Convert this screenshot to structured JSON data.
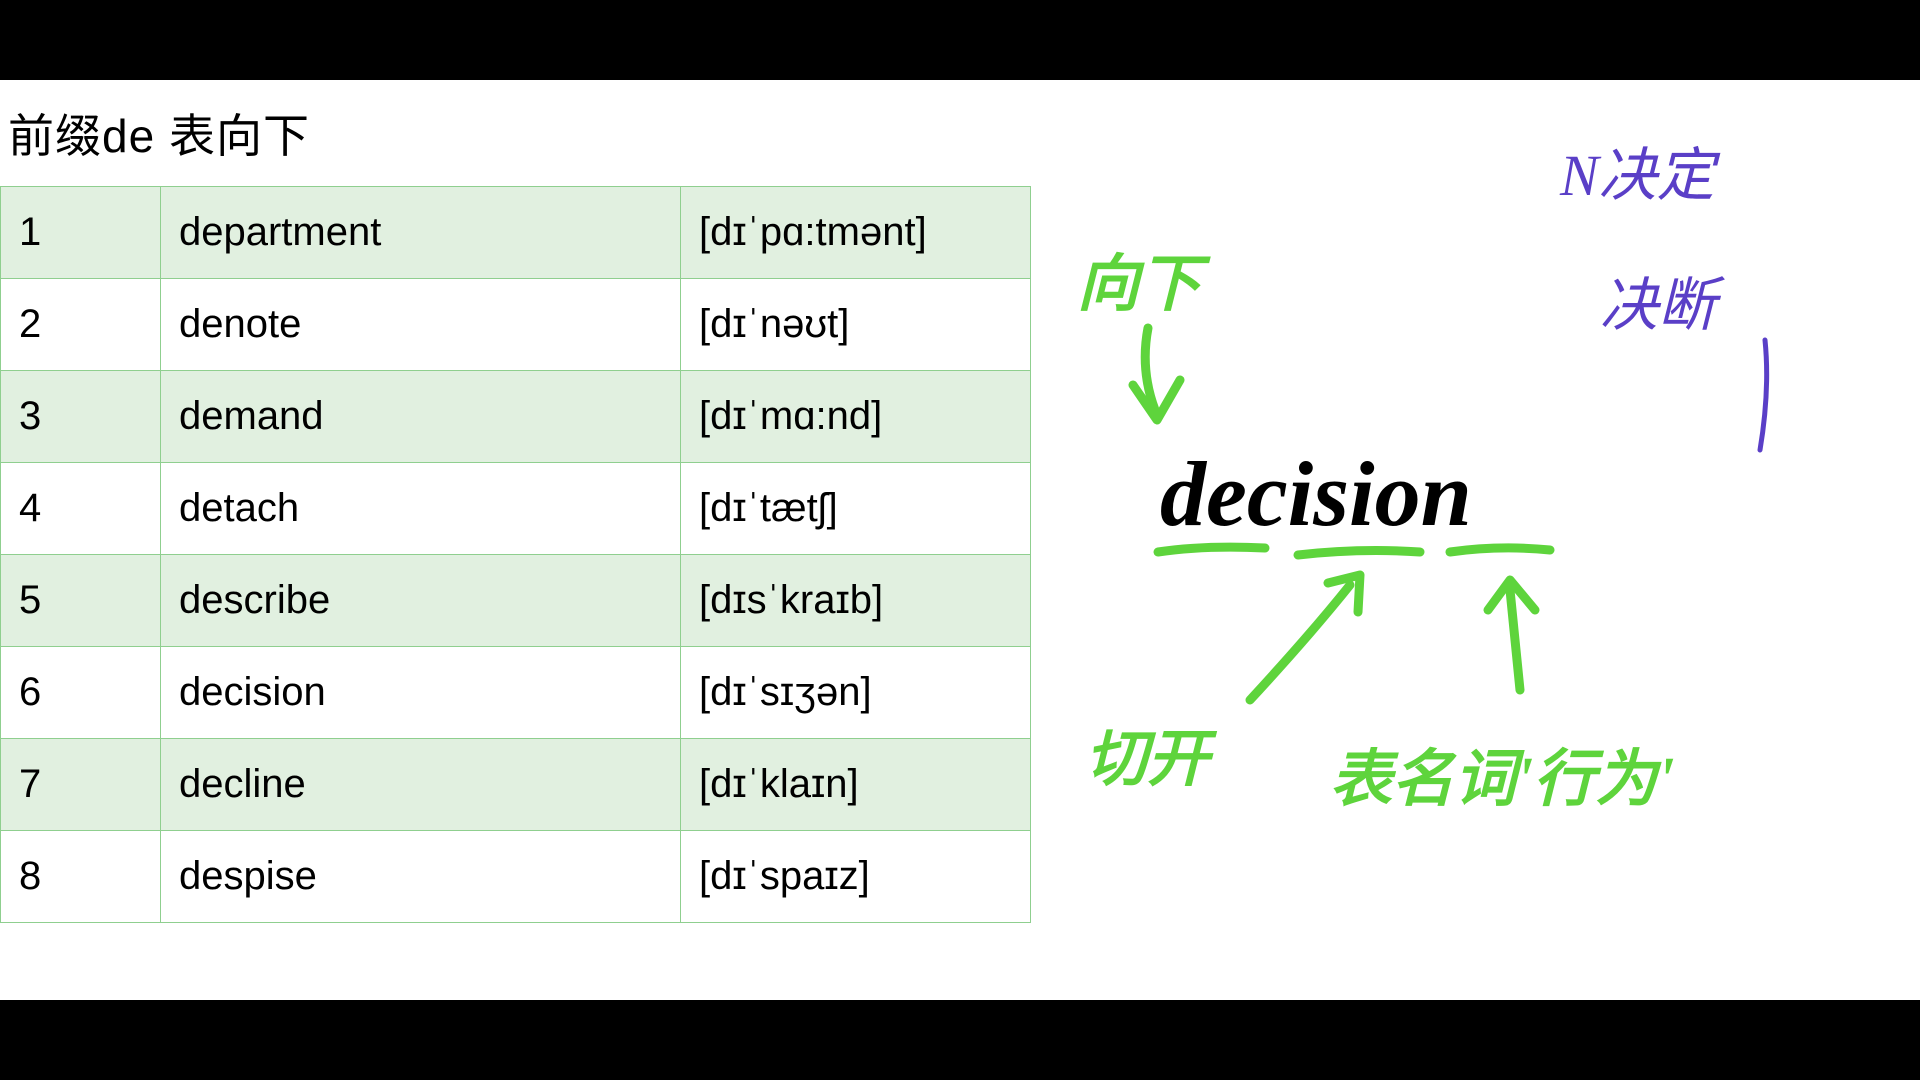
{
  "slide": {
    "title": "前缀de 表向下",
    "rows": [
      {
        "num": "1",
        "word": "department",
        "ipa": "[dɪˈpɑ:tmənt]"
      },
      {
        "num": "2",
        "word": "denote",
        "ipa": "[dɪˈnəʊt]"
      },
      {
        "num": "3",
        "word": "demand",
        "ipa": "[dɪˈmɑ:nd]"
      },
      {
        "num": "4",
        "word": "detach",
        "ipa": "[dɪˈtætʃ]"
      },
      {
        "num": "5",
        "word": "describe",
        "ipa": "[dɪsˈkraɪb]"
      },
      {
        "num": "6",
        "word": "decision",
        "ipa": "[dɪˈsɪʒən]"
      },
      {
        "num": "7",
        "word": "decline",
        "ipa": "[dɪˈklaɪn]"
      },
      {
        "num": "8",
        "word": "despise",
        "ipa": "[dɪˈspaɪz]"
      }
    ]
  },
  "annotations": {
    "main_word": "decision",
    "green_top": "向下",
    "green_left": "切开",
    "green_right": "表名词'行为'",
    "purple_top": "N决定",
    "purple_bottom": "决断"
  },
  "colors": {
    "green": "#5ed43c",
    "purple": "#5a3fc7",
    "black": "#000000"
  }
}
